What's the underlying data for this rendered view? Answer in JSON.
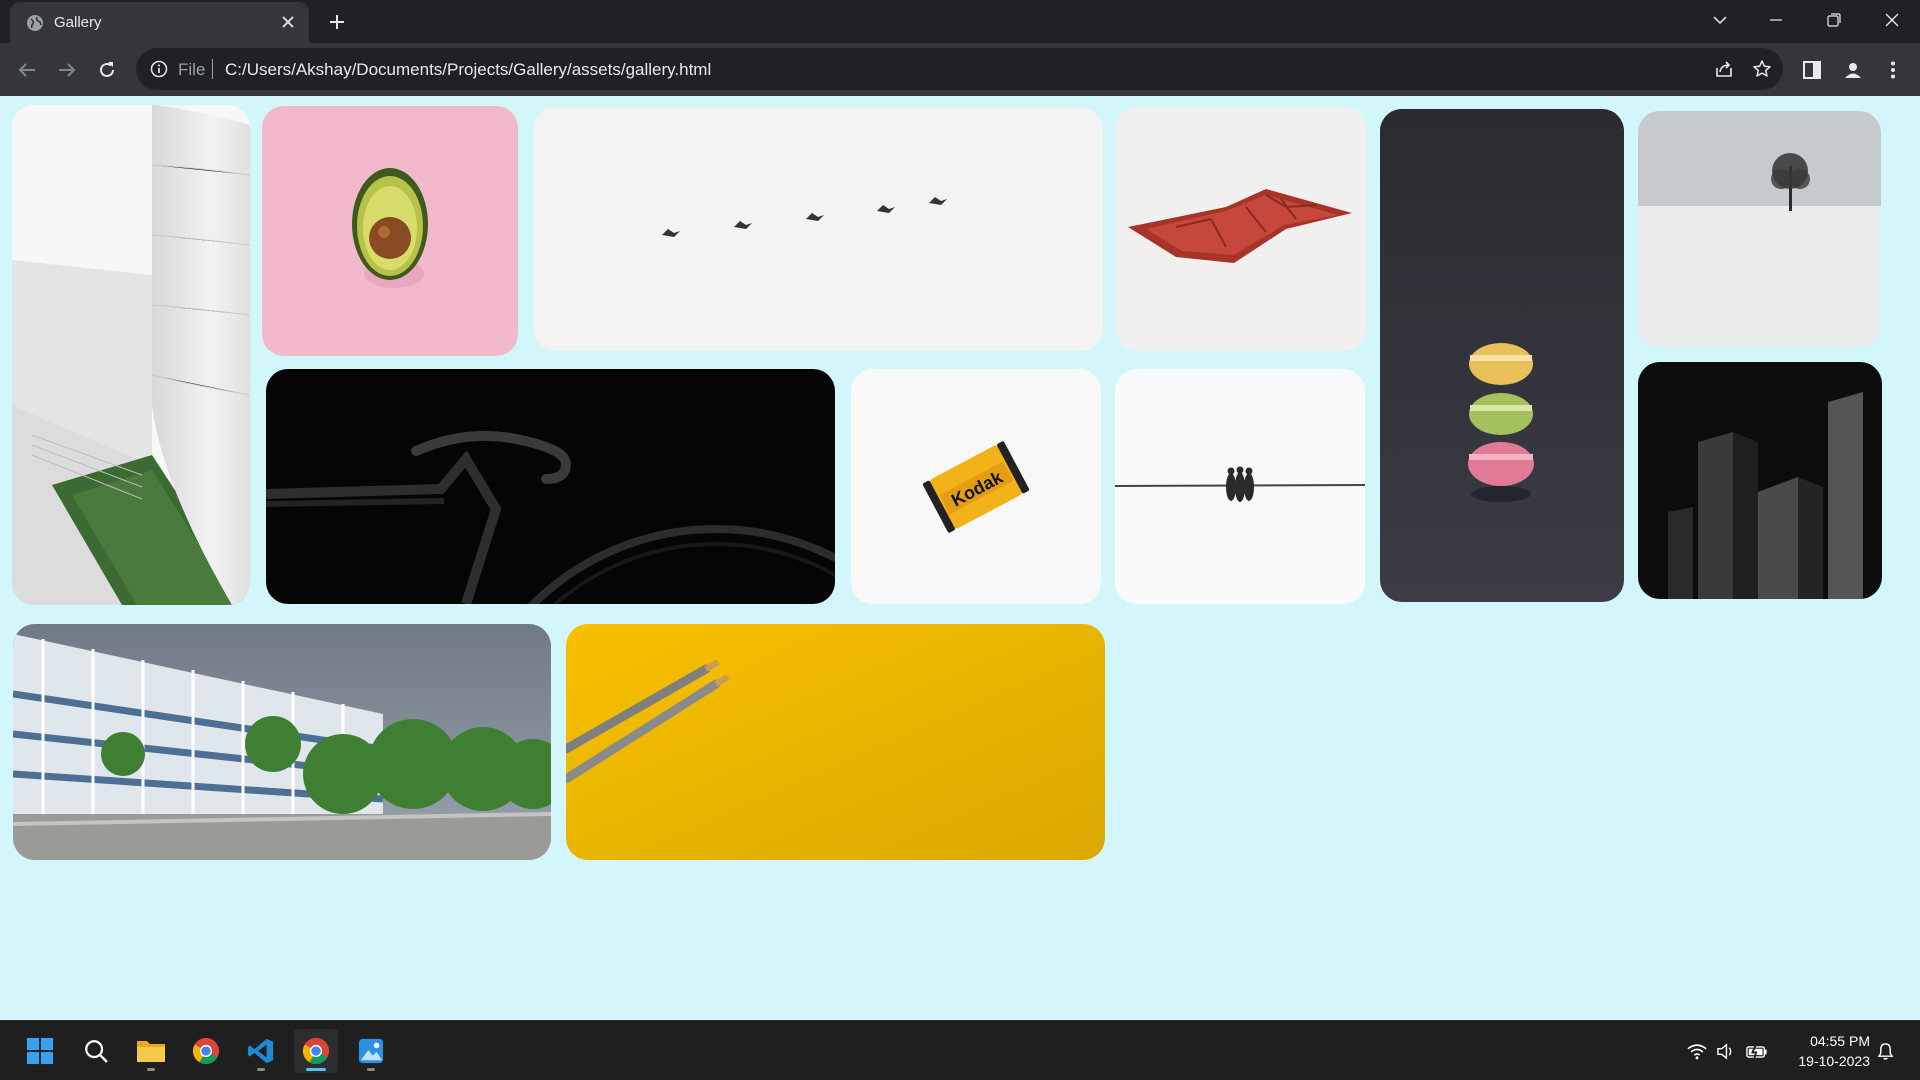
{
  "browser": {
    "tab": {
      "title": "Gallery",
      "favicon": "globe-icon"
    },
    "address": {
      "scheme": "File",
      "url": "C:/Users/Akshay/Documents/Projects/Gallery/assets/gallery.html"
    }
  },
  "gallery": {
    "background": "#d2f6f9",
    "photos": [
      {
        "id": "white-architecture",
        "subject": "white curved building wall with hedge"
      },
      {
        "id": "avocado",
        "subject": "halved avocado on pink background"
      },
      {
        "id": "birds-flight",
        "subject": "five birds flying across pale sky"
      },
      {
        "id": "chocolate-bar",
        "subject": "red wrapped chocolate bar"
      },
      {
        "id": "macarons",
        "subject": "stack of three macarons on dark background"
      },
      {
        "id": "lone-tree",
        "subject": "lone tree in snowy field"
      },
      {
        "id": "bicycle",
        "subject": "black road bicycle on black background"
      },
      {
        "id": "film-canister",
        "subject": "yellow film canister",
        "label": "Kodak"
      },
      {
        "id": "birds-on-wire",
        "subject": "birds perched on a wire"
      },
      {
        "id": "dark-blocks",
        "subject": "dark abstract architecture"
      },
      {
        "id": "glass-building",
        "subject": "glass office building with trees"
      },
      {
        "id": "pencils",
        "subject": "two pencils on yellow background"
      }
    ]
  },
  "taskbar": {
    "apps": [
      "windows-start-icon",
      "search-icon",
      "file-explorer-icon",
      "chrome-icon",
      "vscode-icon",
      "chrome-icon",
      "photos-icon"
    ],
    "clock": {
      "time": "04:55 PM",
      "date": "19-10-2023"
    }
  }
}
